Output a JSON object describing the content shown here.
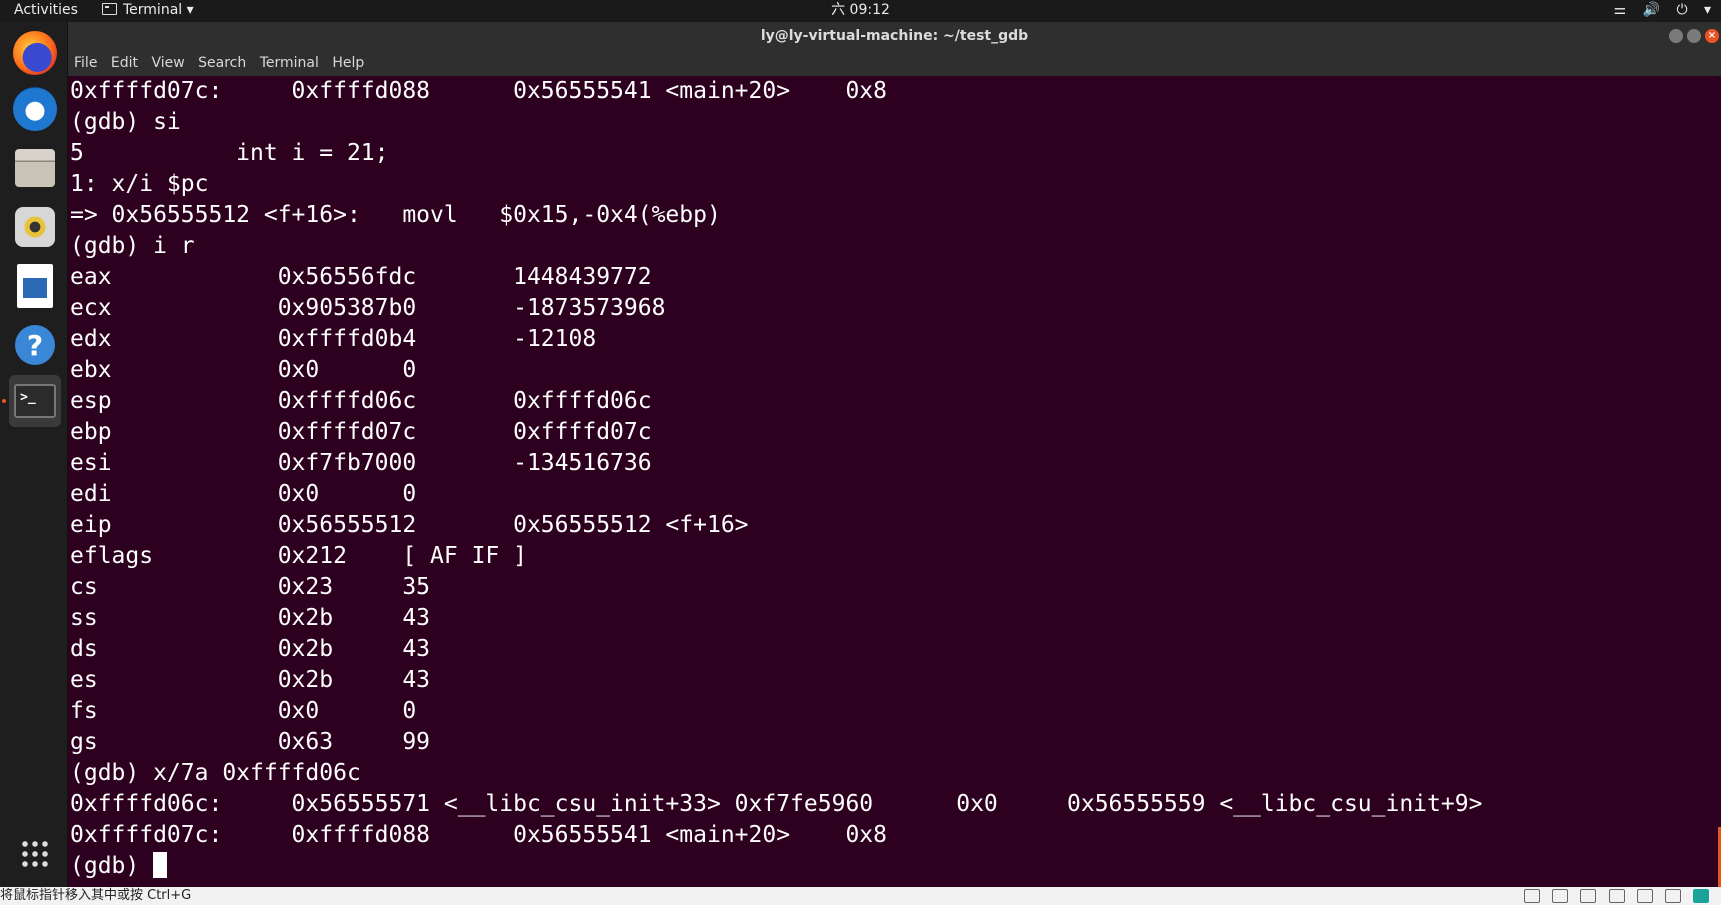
{
  "topbar": {
    "activities": "Activities",
    "app_menu": "Terminal ▾",
    "clock": "六 09:12",
    "tray_icons": [
      "network-icon",
      "volume-icon",
      "power-icon",
      "chevron-down-icon"
    ],
    "tray_glyphs": {
      "network": "⚌",
      "volume": "🔊",
      "power": "⏻",
      "chevron": "▾"
    }
  },
  "dock": {
    "items": [
      {
        "name": "firefox-icon"
      },
      {
        "name": "thunderbird-icon"
      },
      {
        "name": "files-icon"
      },
      {
        "name": "rhythmbox-icon"
      },
      {
        "name": "libreoffice-writer-icon"
      },
      {
        "name": "help-icon",
        "glyph": "?"
      },
      {
        "name": "terminal-icon",
        "glyph": ">_",
        "active": true
      },
      {
        "name": "show-applications-icon"
      }
    ]
  },
  "window": {
    "title": "ly@ly-virtual-machine: ~/test_gdb",
    "close_glyph": "×"
  },
  "menubar": [
    "File",
    "Edit",
    "View",
    "Search",
    "Terminal",
    "Help"
  ],
  "terminal": {
    "lines": [
      "0xffffd07c:     0xffffd088      0x56555541 <main+20>    0x8",
      "(gdb) si",
      "5           int i = 21;",
      "1: x/i $pc",
      "=> 0x56555512 <f+16>:   movl   $0x15,-0x4(%ebp)",
      "(gdb) i r",
      "eax            0x56556fdc       1448439772",
      "ecx            0x905387b0       -1873573968",
      "edx            0xffffd0b4       -12108",
      "ebx            0x0      0",
      "esp            0xffffd06c       0xffffd06c",
      "ebp            0xffffd07c       0xffffd07c",
      "esi            0xf7fb7000       -134516736",
      "edi            0x0      0",
      "eip            0x56555512       0x56555512 <f+16>",
      "eflags         0x212    [ AF IF ]",
      "cs             0x23     35",
      "ss             0x2b     43",
      "ds             0x2b     43",
      "es             0x2b     43",
      "fs             0x0      0",
      "gs             0x63     99",
      "(gdb) x/7a 0xffffd06c",
      "0xffffd06c:     0x56555571 <__libc_csu_init+33> 0xf7fe5960      0x0     0x56555559 <__libc_csu_init+9>",
      "0xffffd07c:     0xffffd088      0x56555541 <main+20>    0x8"
    ],
    "prompt": "(gdb) "
  },
  "statusbar": {
    "hint": "将鼠标指针移入其中或按 Ctrl+G"
  }
}
